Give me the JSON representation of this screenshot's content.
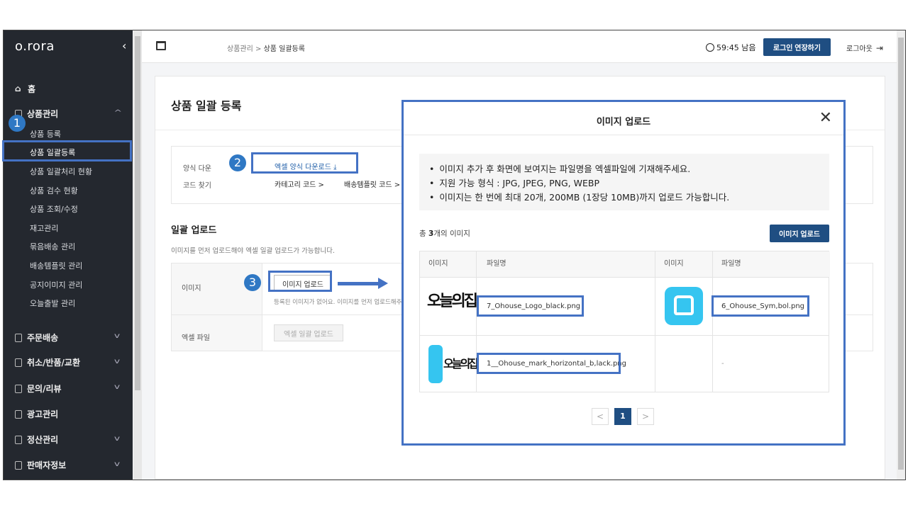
{
  "app": {
    "logo": "o.rora",
    "collapse_icon": "chevron-left"
  },
  "sidebar": {
    "home": "홈",
    "product_mgmt": "상품관리",
    "sub_items": [
      "상품 등록",
      "상품 일괄등록",
      "상품 일괄처리 현황",
      "상품 검수 현황",
      "상품 조회/수정",
      "재고관리",
      "묶음배송 관리",
      "배송템플릿 관리",
      "공지이미지 관리",
      "오늘출발 관리"
    ],
    "sections": [
      "주문배송",
      "취소/반품/교환",
      "문의/리뷰",
      "광고관리",
      "정산관리",
      "판매자정보"
    ]
  },
  "topbar": {
    "breadcrumb_parent": "상품관리",
    "breadcrumb_sep": ">",
    "breadcrumb_current": "상품 일괄등록",
    "timer": "59:45 남음",
    "extend_label": "로그인 연장하기",
    "logout_label": "로그아웃"
  },
  "page": {
    "title": "상품 일괄 등록",
    "template_label": "양식 다운",
    "template_link": "엑셀 양식 다운로드 ⤓",
    "code_label": "코드 찾기",
    "code_category": "카테고리 코드 >",
    "code_template": "배송템플릿 코드 >",
    "bulk_title": "일괄 업로드",
    "bulk_desc": "이미지를 먼저 업로드해야 엑셀 일괄 업로드가 가능합니다.",
    "image_label": "이미지",
    "image_btn": "이미지 업로드",
    "image_empty": "등록된 이미지가 없어요. 이미지를 먼저 업로드해주세",
    "excel_label": "엑셀 파일",
    "excel_btn": "엑셀 일괄 업로드"
  },
  "annotations": {
    "b1": "1",
    "b2": "2",
    "b3": "3"
  },
  "modal": {
    "title": "이미지 업로드",
    "info": [
      "이미지 추가 후 화면에 보여지는 파일명을 엑셀파일에 기재해주세요.",
      "지원 가능 형식 : JPG, JPEG, PNG, WEBP",
      "이미지는 한 번에 최대 20개, 200MB (1장당 10MB)까지 업로드 가능합니다."
    ],
    "count_prefix": "총 ",
    "count_value": "3",
    "count_suffix": "개의 이미지",
    "upload_btn": "이미지 업로드",
    "headers": [
      "이미지",
      "파일명",
      "이미지",
      "파일명"
    ],
    "files": [
      "7_Ohouse_Logo_black.png",
      "6_Ohouse_Sym,bol.png",
      "1__Ohouse_mark_horizontal_b,lack.png"
    ],
    "empty_cell": "-",
    "logo_text": "오늘의집",
    "page_current": "1",
    "prev": "<",
    "next": ">"
  },
  "colors": {
    "accent": "#1f4e82",
    "annotation": "#4472c4",
    "brand": "#35c5f0",
    "sidebar_bg": "#24282f"
  }
}
